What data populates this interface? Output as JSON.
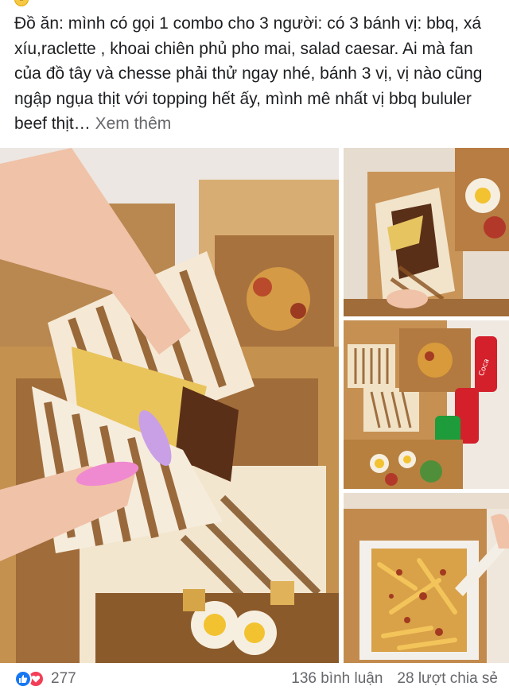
{
  "post": {
    "text": "Đồ ăn: mình có gọi 1 combo cho 3 người: có 3 bánh vị: bbq, xá xíu,raclette , khoai chiên phủ pho mai, salad caesar. Ai mà fan của đồ tây và chesse phải thử ngay nhé, bánh 3 vị, vị nào cũng ngập ngụa thịt với topping hết ấy, mình mê nhất vị bbq bululer beef thịt…",
    "see_more": "Xem thêm"
  },
  "footer": {
    "reaction_count": "277",
    "comments": "136 bình luận",
    "shares": "28 lượt chia sẻ"
  },
  "photos": {
    "main": "sandwich-photo",
    "top_right": "sandwich-closeup-photo",
    "middle_right": "combo-boxes-photo",
    "bottom_right": "cheese-fries-photo"
  },
  "colors": {
    "like": "#1877f2",
    "love": "#f33e58",
    "muted_text": "#65676b",
    "cardboard": "#c9955a"
  }
}
